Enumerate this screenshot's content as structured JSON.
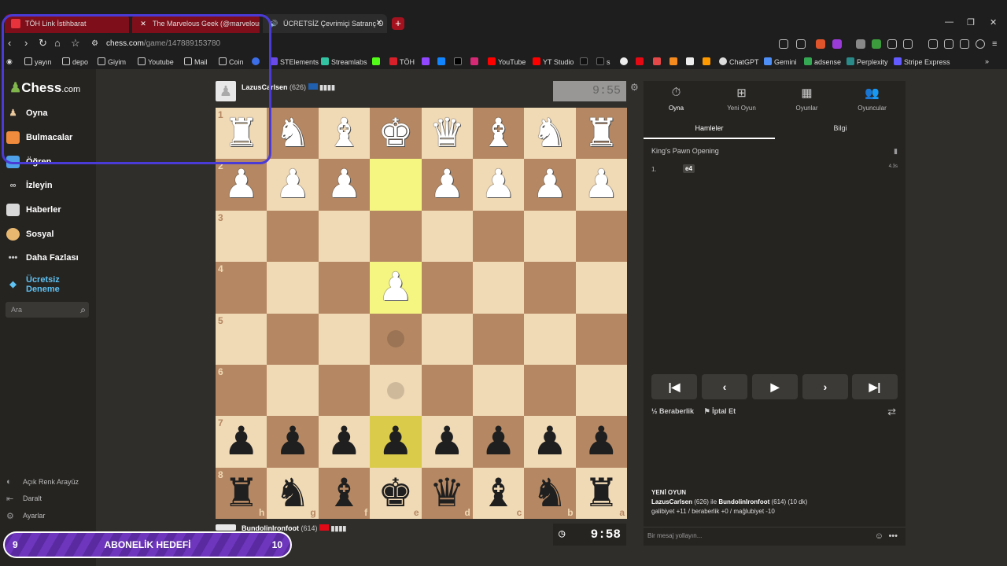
{
  "browser": {
    "tabs": [
      {
        "title": "TÖH Link İstihbarat"
      },
      {
        "title": "The Marvelous Geek (@marvelousge"
      },
      {
        "title": "ÜCRETSİZ Çevrimiçi Satranç O"
      }
    ],
    "url_host": "chess.com",
    "url_path": "/game/147889153780",
    "bookmarks": [
      "yayın",
      "depo",
      "Giyim",
      "Youtube",
      "Mail",
      "Coin",
      "STElements",
      "Streamlabs",
      "TÖH",
      "YouTube",
      "YT Studio",
      "s",
      "ChatGPT",
      "Gemini",
      "adsense",
      "Perplexity",
      "Stripe Express"
    ]
  },
  "sidebar": {
    "logo": "Chess",
    "logo_suffix": ".com",
    "items": [
      {
        "label": "Oyna"
      },
      {
        "label": "Bulmacalar"
      },
      {
        "label": "Öğren"
      },
      {
        "label": "İzleyin"
      },
      {
        "label": "Haberler"
      },
      {
        "label": "Sosyal"
      },
      {
        "label": "Daha Fazlası"
      },
      {
        "label": "Ücretsiz Deneme"
      }
    ],
    "search_placeholder": "Ara",
    "footer": [
      {
        "label": "Açık Renk Arayüz"
      },
      {
        "label": "Daralt"
      },
      {
        "label": "Ayarlar"
      }
    ]
  },
  "game": {
    "top_player": {
      "name": "LazusCarlsen",
      "rating": "(626)",
      "clock": "9:55"
    },
    "bottom_player": {
      "name": "BundolinIronfoot",
      "rating": "(614)",
      "clock": "9:58"
    },
    "ranks": [
      "1",
      "2",
      "3",
      "4",
      "5",
      "6",
      "7",
      "8"
    ],
    "files": [
      "h",
      "g",
      "f",
      "e",
      "d",
      "c",
      "b",
      "a"
    ],
    "board": [
      [
        "wR",
        "wN",
        "wB",
        "wK",
        "wQ",
        "wB",
        "wN",
        "wR"
      ],
      [
        "wP",
        "wP",
        "wP",
        "",
        "wP",
        "wP",
        "wP",
        "wP"
      ],
      [
        "",
        "",
        "",
        "",
        "",
        "",
        "",
        ""
      ],
      [
        "",
        "",
        "",
        "wP",
        "",
        "",
        "",
        ""
      ],
      [
        "",
        "",
        "",
        "",
        "",
        "",
        "",
        ""
      ],
      [
        "",
        "",
        "",
        "",
        "",
        "",
        "",
        ""
      ],
      [
        "bP",
        "bP",
        "bP",
        "bP",
        "bP",
        "bP",
        "bP",
        "bP"
      ],
      [
        "bR",
        "bN",
        "bB",
        "bK",
        "bQ",
        "bB",
        "bN",
        "bR"
      ]
    ],
    "highlights": [
      [
        1,
        3
      ],
      [
        3,
        3
      ],
      [
        6,
        3
      ]
    ],
    "hints": [
      [
        4,
        3
      ],
      [
        5,
        3
      ]
    ]
  },
  "panel": {
    "tabs": [
      {
        "label": "Oyna"
      },
      {
        "label": "Yeni Oyun"
      },
      {
        "label": "Oyunlar"
      },
      {
        "label": "Oyuncular"
      }
    ],
    "subtabs": [
      {
        "label": "Hamleler"
      },
      {
        "label": "Bilgi"
      }
    ],
    "opening": "King's Pawn Opening",
    "moves": [
      {
        "num": "1.",
        "white": "e4",
        "time": "4.3s"
      }
    ],
    "draw_label": "Beraberlik",
    "abort_label": "İptal Et",
    "new_game_title": "YENİ OYUN",
    "new_game_white": "LazusCarlsen",
    "new_game_white_rating": " (626) ile ",
    "new_game_black": "BundolinIronfoot",
    "new_game_black_rating": " (614) (10 dk)",
    "new_game_stats": "galibiyet +11 / beraberlik +0 / mağlubiyet -10",
    "chat_placeholder": "Bir mesaj yollayın..."
  },
  "overlay": {
    "goal_current": "9",
    "goal_label": "ABONELİK HEDEFİ",
    "goal_target": "10"
  },
  "colors": {
    "accent": "#81b64c",
    "highlight": "#f5f682",
    "overlay_purple": "#5a2aa1",
    "box": "#4b3bd6"
  }
}
